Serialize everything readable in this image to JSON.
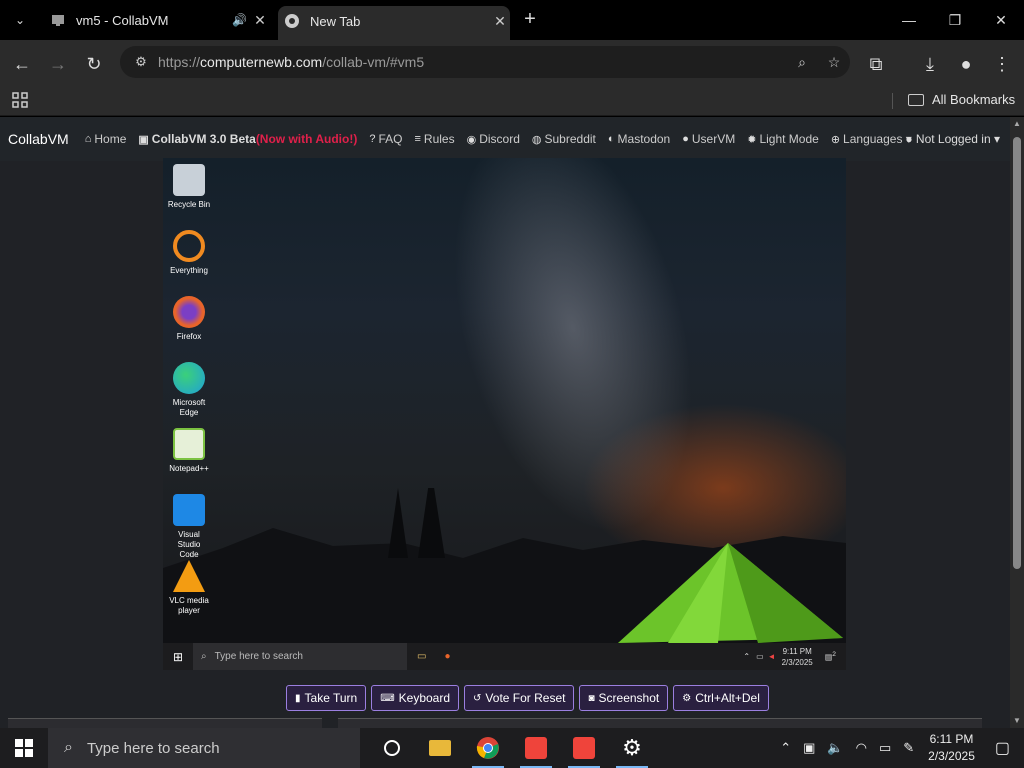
{
  "browser": {
    "tabs": [
      {
        "title": "vm5 - CollabVM",
        "audio_icon": "speaker-icon",
        "close": "✕"
      },
      {
        "title": "New Tab",
        "close": "✕"
      }
    ],
    "new_tab": "+",
    "window_controls": {
      "minimize": "—",
      "restore": "❐",
      "close": "✕"
    },
    "url_scheme": "https://",
    "url_host": "computernewb.com",
    "url_path": "/collab-vm/#vm5",
    "bookmarks_label": "All Bookmarks"
  },
  "site": {
    "brand": "CollabVM",
    "nav": [
      {
        "icon": "⌂",
        "label": "Home"
      },
      {
        "icon": "▣",
        "label": "CollabVM 3.0 Beta",
        "extra": " (Now with Audio!)"
      },
      {
        "icon": "?",
        "label": "FAQ"
      },
      {
        "icon": "≡",
        "label": "Rules"
      },
      {
        "icon": "◉",
        "label": "Discord"
      },
      {
        "icon": "◍",
        "label": "Subreddit"
      },
      {
        "icon": "◐",
        "label": "Mastodon"
      },
      {
        "icon": "●",
        "label": "UserVM"
      },
      {
        "icon": "✹",
        "label": "Light Mode"
      },
      {
        "icon": "⊕",
        "label": "Languages ▾"
      }
    ],
    "login": "Not Logged in ▾"
  },
  "vm": {
    "desktop_icons": [
      {
        "label": "Recycle Bin",
        "color": "#c8d0d8"
      },
      {
        "label": "Everything",
        "color": "#f08a20"
      },
      {
        "label": "Firefox",
        "color": "#e8642a"
      },
      {
        "label": "Microsoft Edge",
        "color": "#1fa0d8"
      },
      {
        "label": "Notepad++",
        "color": "#7cc242"
      },
      {
        "label": "Visual Studio Code",
        "color": "#1e88e5"
      },
      {
        "label": "VLC media player",
        "color": "#f39c12"
      }
    ],
    "taskbar": {
      "search_placeholder": "Type here to search",
      "time": "9:11 PM",
      "date": "2/3/2025",
      "notifications": "2"
    }
  },
  "actions": [
    {
      "icon": "▮",
      "label": "Take Turn"
    },
    {
      "icon": "⌨",
      "label": "Keyboard"
    },
    {
      "icon": "↺",
      "label": "Vote For Reset"
    },
    {
      "icon": "◙",
      "label": "Screenshot"
    },
    {
      "icon": "⚙",
      "label": "Ctrl+Alt+Del"
    }
  ],
  "host_taskbar": {
    "search_placeholder": "Type here to search",
    "time": "6:11 PM",
    "date": "2/3/2025"
  }
}
